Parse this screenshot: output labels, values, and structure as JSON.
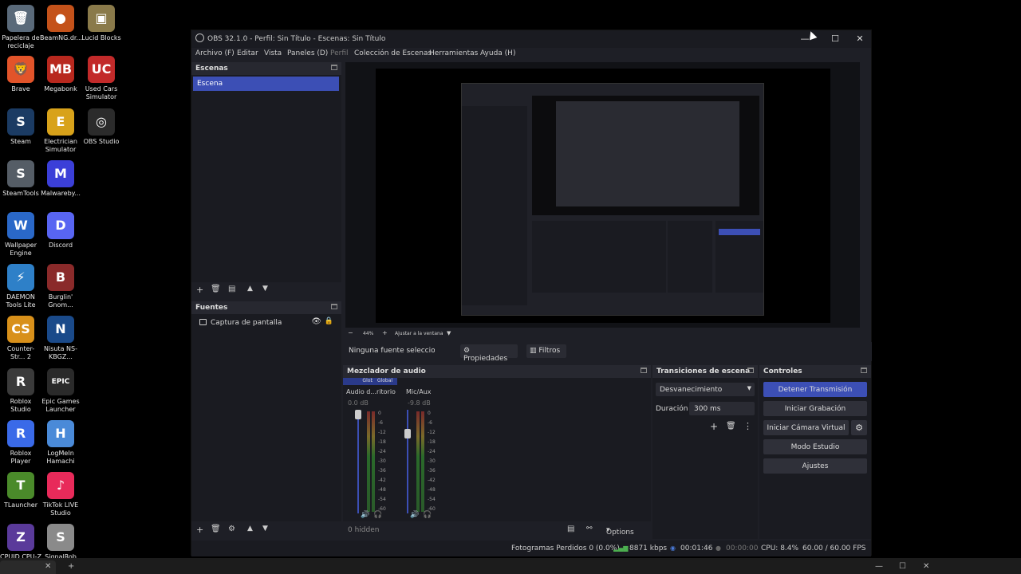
{
  "desktop": {
    "icons": [
      {
        "label": "Papelera de reciclaje",
        "color": "#5a6a7a",
        "glyph": "🗑"
      },
      {
        "label": "BeamNG.dr...",
        "color": "#c4521a",
        "glyph": "●"
      },
      {
        "label": "Lucid Blocks",
        "color": "#8a7a4a",
        "glyph": "▣"
      },
      {
        "label": "Brave",
        "color": "#e2542a",
        "glyph": "🦁"
      },
      {
        "label": "Megabonk",
        "color": "#b8281e",
        "glyph": "MB"
      },
      {
        "label": "Used Cars Simulator",
        "color": "#c22a2a",
        "glyph": "UC"
      },
      {
        "label": "Steam",
        "color": "#1b3b63",
        "glyph": "S"
      },
      {
        "label": "Electrician Simulator",
        "color": "#d8a21a",
        "glyph": "E"
      },
      {
        "label": "OBS Studio",
        "color": "#2b2b2b",
        "glyph": "◎"
      },
      {
        "label": "SteamTools",
        "color": "#555d66",
        "glyph": "S"
      },
      {
        "label": "Malwareby...",
        "color": "#3b3fd8",
        "glyph": "M"
      },
      {
        "label": "Wallpaper Engine",
        "color": "#2a68c8",
        "glyph": "W"
      },
      {
        "label": "Discord",
        "color": "#5865f2",
        "glyph": "D"
      },
      {
        "label": "DAEMON Tools Lite",
        "color": "#2e80c8",
        "glyph": "⚡"
      },
      {
        "label": "Burglin' Gnom...",
        "color": "#8a2a2a",
        "glyph": "B"
      },
      {
        "label": "Counter-Str... 2",
        "color": "#d8901a",
        "glyph": "CS"
      },
      {
        "label": "Nisuta NS-KBGZ...",
        "color": "#1a4a8a",
        "glyph": "N"
      },
      {
        "label": "Roblox Studio",
        "color": "#3a3a3a",
        "glyph": "R"
      },
      {
        "label": "Epic Games Launcher",
        "color": "#2a2a2a",
        "glyph": "EPIC"
      },
      {
        "label": "Roblox Player",
        "color": "#3a6ae8",
        "glyph": "R"
      },
      {
        "label": "LogMeIn Hamachi",
        "color": "#4a8ad8",
        "glyph": "H"
      },
      {
        "label": "TLauncher",
        "color": "#4a8a2a",
        "glyph": "T"
      },
      {
        "label": "TikTok LIVE Studio",
        "color": "#e82a5a",
        "glyph": "♪"
      },
      {
        "label": "CPUID CPU-Z",
        "color": "#5a3a9a",
        "glyph": "Z"
      },
      {
        "label": "SignalRob",
        "color": "#8a8a8a",
        "glyph": "S"
      }
    ]
  },
  "window": {
    "title": "OBS 32.1.0 - Perfil: Sin Título - Escenas: Sin Título",
    "minimize": "—",
    "maximize": "☐",
    "close": "✕"
  },
  "menu": [
    "Archivo (F)",
    "Editar",
    "Vista",
    "Paneles (D)",
    "Perfil",
    "Colección de Escenas",
    "Herramientas",
    "Ayuda (H)"
  ],
  "scenes": {
    "title": "Escenas",
    "items": [
      "Escena"
    ]
  },
  "sources": {
    "title": "Fuentes",
    "items": [
      "Captura de pantalla"
    ]
  },
  "preview": {
    "zoom": "44%",
    "fit": "Ajustar a la ventana"
  },
  "source_toolbar": {
    "none_selected": "Ninguna fuente seleccionada",
    "properties": "Propiedades",
    "filters": "Filtros"
  },
  "mixer": {
    "title": "Mezclador de audio",
    "channels": [
      {
        "global": "Global",
        "name": "Audio d...ritorio",
        "db": "0.0 dB",
        "fader": 0.0
      },
      {
        "global": "Global",
        "name": "Mic/Aux",
        "db": "-9.8 dB",
        "fader": 0.6
      }
    ],
    "scale": [
      "0",
      "-6",
      "-12",
      "-18",
      "-24",
      "-30",
      "-36",
      "-42",
      "-48",
      "-54",
      "-60"
    ],
    "hidden": "0 hidden",
    "options": "Options"
  },
  "transitions": {
    "title": "Transiciones de escena",
    "type": "Desvanecimiento",
    "duration_label": "Duración",
    "duration": "300 ms"
  },
  "controls": {
    "title": "Controles",
    "stop_stream": "Detener Transmisión",
    "start_record": "Iniciar Grabación",
    "start_vcam": "Iniciar Cámara Virtual",
    "studio_mode": "Modo Estudio",
    "settings": "Ajustes"
  },
  "status": {
    "dropped": "Fotogramas Perdidos 0 (0.0%)",
    "bitrate": "8871 kbps",
    "stream_time": "00:01:46",
    "rec_time": "00:00:00",
    "cpu": "CPU: 8.4%",
    "fps": "60.00 / 60.00 FPS"
  },
  "taskbar": {
    "close": "✕",
    "add": "+",
    "min": "—",
    "max": "☐",
    "x": "✕"
  }
}
